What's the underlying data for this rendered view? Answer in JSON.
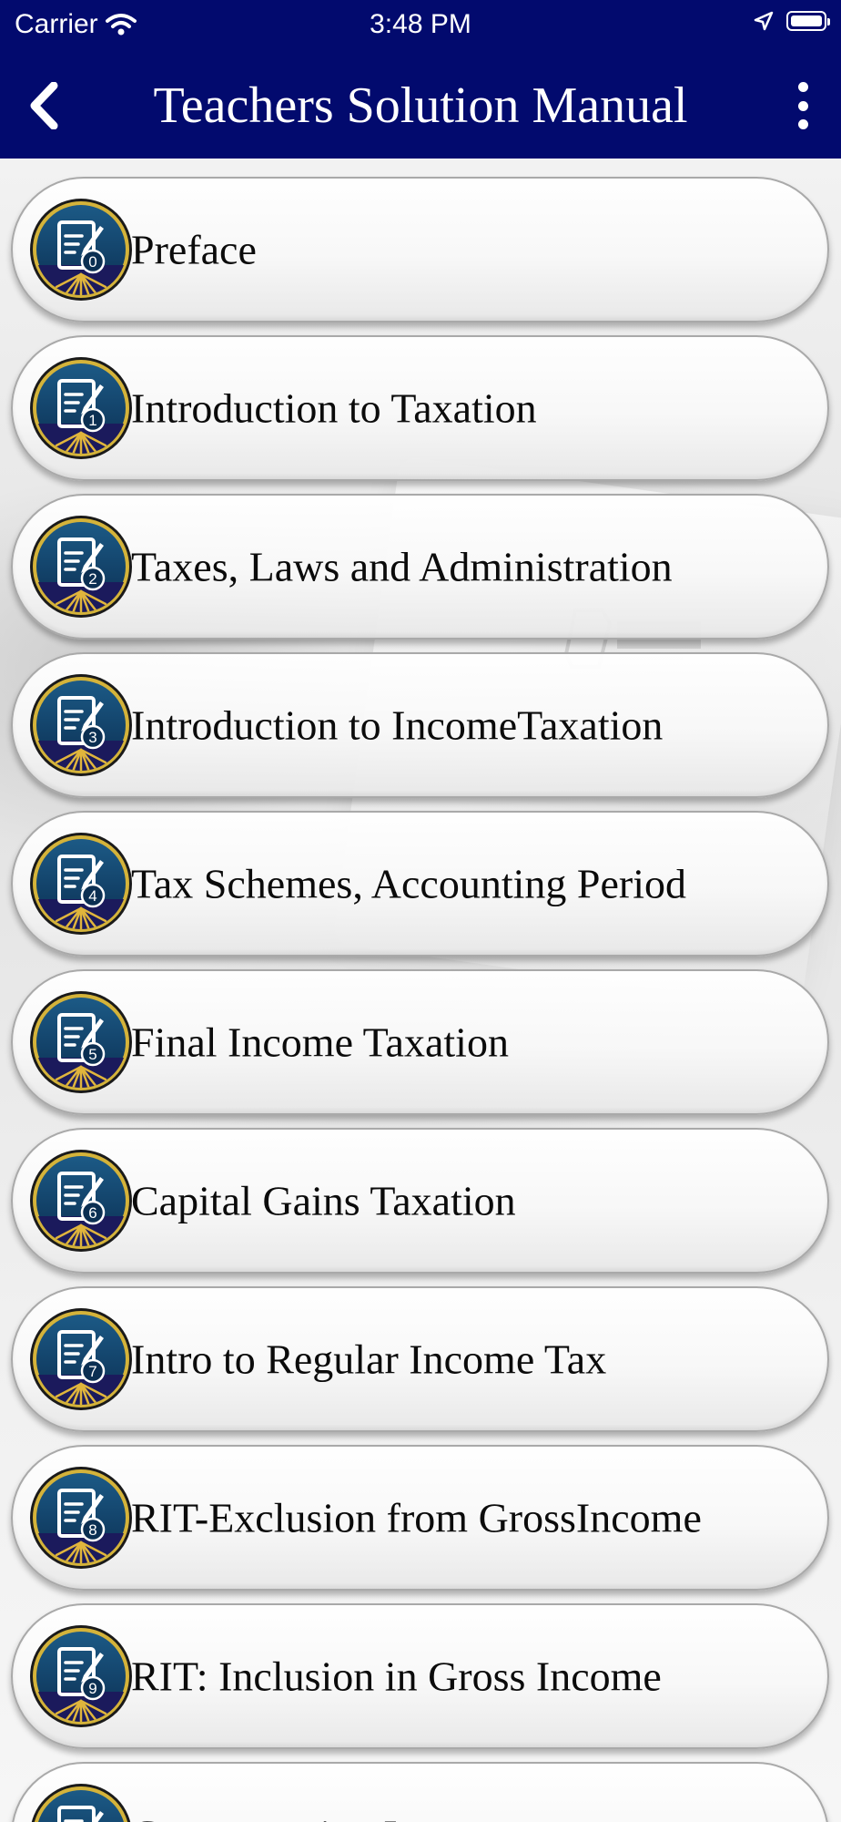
{
  "status_bar": {
    "carrier": "Carrier",
    "time": "3:48 PM"
  },
  "header": {
    "title": "Teachers Solution Manual"
  },
  "chapters": [
    {
      "number": "0",
      "label": "Preface"
    },
    {
      "number": "1",
      "label": "Introduction to Taxation"
    },
    {
      "number": "2",
      "label": "Taxes, Laws and Administration"
    },
    {
      "number": "3",
      "label": "Introduction to IncomeTaxation"
    },
    {
      "number": "4",
      "label": "Tax Schemes, Accounting Period"
    },
    {
      "number": "5",
      "label": "Final Income Taxation"
    },
    {
      "number": "6",
      "label": "Capital Gains Taxation"
    },
    {
      "number": "7",
      "label": "Intro to Regular Income Tax"
    },
    {
      "number": "8",
      "label": "RIT-Exclusion from GrossIncome"
    },
    {
      "number": "9",
      "label": "RIT: Inclusion in Gross Income"
    },
    {
      "number": "",
      "label": "Compensation Income"
    }
  ],
  "colors": {
    "header_bg": "#020a6e",
    "icon_bg": "#0d3b66",
    "icon_ring": "#d4b33a",
    "icon_base": "#1b1a5c"
  },
  "icons": {
    "back": "chevron-left-icon",
    "more": "more-vertical-icon",
    "chapter": "document-edit-icon"
  }
}
